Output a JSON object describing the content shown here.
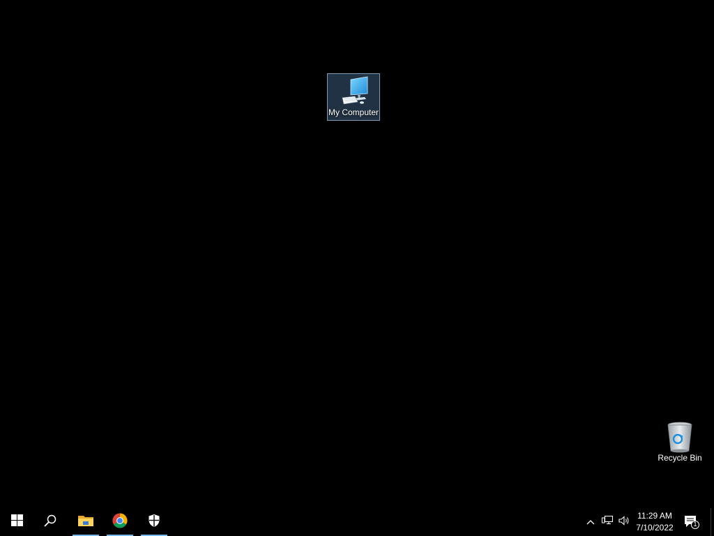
{
  "desktop": {
    "background": "#000000",
    "icons": [
      {
        "label": "My Computer",
        "icon": "computer-icon",
        "selected": true
      },
      {
        "label": "Recycle Bin",
        "icon": "recycle-bin-icon",
        "selected": false
      }
    ]
  },
  "taskbar": {
    "background": "#000000",
    "accent": "#76b9ed",
    "buttons": [
      {
        "name": "start",
        "icon": "windows-logo-icon"
      },
      {
        "name": "search",
        "icon": "search-icon"
      },
      {
        "name": "file-explorer",
        "icon": "folder-icon",
        "active": true
      },
      {
        "name": "chrome",
        "icon": "chrome-icon",
        "active": true
      },
      {
        "name": "windows-security",
        "icon": "shield-icon",
        "active": true
      }
    ],
    "tray": {
      "icons": [
        "chevron-up-icon",
        "network-icon",
        "volume-icon"
      ],
      "time": "11:29 AM",
      "date": "7/10/2022",
      "notification_count": "1"
    }
  }
}
